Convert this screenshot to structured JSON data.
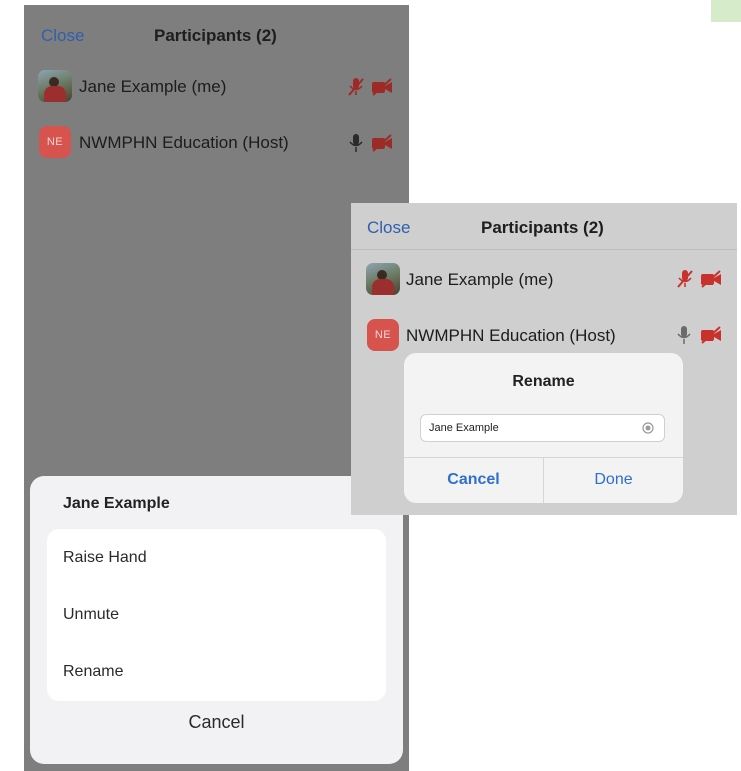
{
  "left_panel": {
    "close_label": "Close",
    "title": "Participants (2)",
    "participants": [
      {
        "name": "Jane Example (me)",
        "avatar": "photo",
        "mic_icon": "mic-muted-icon",
        "video_icon": "video-off-icon"
      },
      {
        "name": "NWMPHN Education (Host)",
        "avatar_initials": "NE",
        "mic_icon": "mic-icon",
        "video_icon": "video-off-icon"
      }
    ],
    "action_sheet": {
      "title": "Jane Example",
      "items": [
        "Raise Hand",
        "Unmute",
        "Rename"
      ],
      "cancel_label": "Cancel"
    }
  },
  "right_panel": {
    "close_label": "Close",
    "title": "Participants (2)",
    "participants": [
      {
        "name": "Jane Example (me)",
        "avatar": "photo",
        "mic_icon": "mic-muted-icon",
        "video_icon": "video-off-icon"
      },
      {
        "name": "NWMPHN Education (Host)",
        "avatar_initials": "NE",
        "mic_icon": "mic-icon",
        "video_icon": "video-off-icon"
      }
    ],
    "rename_dialog": {
      "title": "Rename",
      "input_value": "Jane Example",
      "cancel_label": "Cancel",
      "done_label": "Done"
    }
  },
  "colors": {
    "link_blue": "#2f5fae",
    "button_blue": "#2f6fd0",
    "muted_red": "#c8312c",
    "avatar_red": "#d6534e",
    "dim_overlay": "#7e7e7e"
  }
}
